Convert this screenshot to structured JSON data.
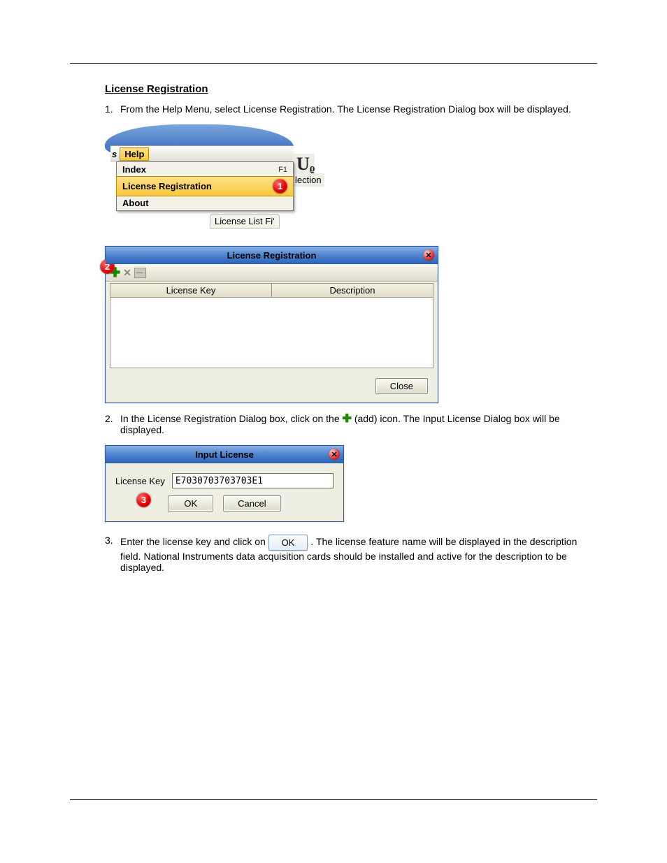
{
  "section_title": "License Registration",
  "steps": {
    "s1_num": "1.",
    "s1_txt": "From the Help Menu, select License Registration. The License Registration Dialog box will be displayed.",
    "s2_num": "2.",
    "s2_txt_a": "In the License Registration Dialog box, click on the ",
    "s2_txt_b": " (add) icon. The Input License Dialog box will be displayed.",
    "s3_num": "3.",
    "s3_txt_a": "Enter the license key and click on ",
    "s3_txt_b": ". The license feature name will be displayed in the description field. National Instruments data acquisition cards should be installed and active for the description to be displayed."
  },
  "help_menu": {
    "partial_s": "s",
    "help": "Help",
    "index": "Index",
    "index_shortcut": "F1",
    "license_registration": "License Registration",
    "about": "About",
    "partial_up": "Uᵨ",
    "lection": "lection",
    "license_list": "License List Fiʹ"
  },
  "callouts": {
    "c1": "1",
    "c2": "2",
    "c3": "3"
  },
  "dlg_reg": {
    "title": "License Registration",
    "col_key": "License Key",
    "col_desc": "Description",
    "close": "Close"
  },
  "dlg_input": {
    "title": "Input License",
    "label": "License Key",
    "value": "E7030703703703E1",
    "ok": "OK",
    "cancel": "Cancel"
  },
  "inline_ok": "OK"
}
